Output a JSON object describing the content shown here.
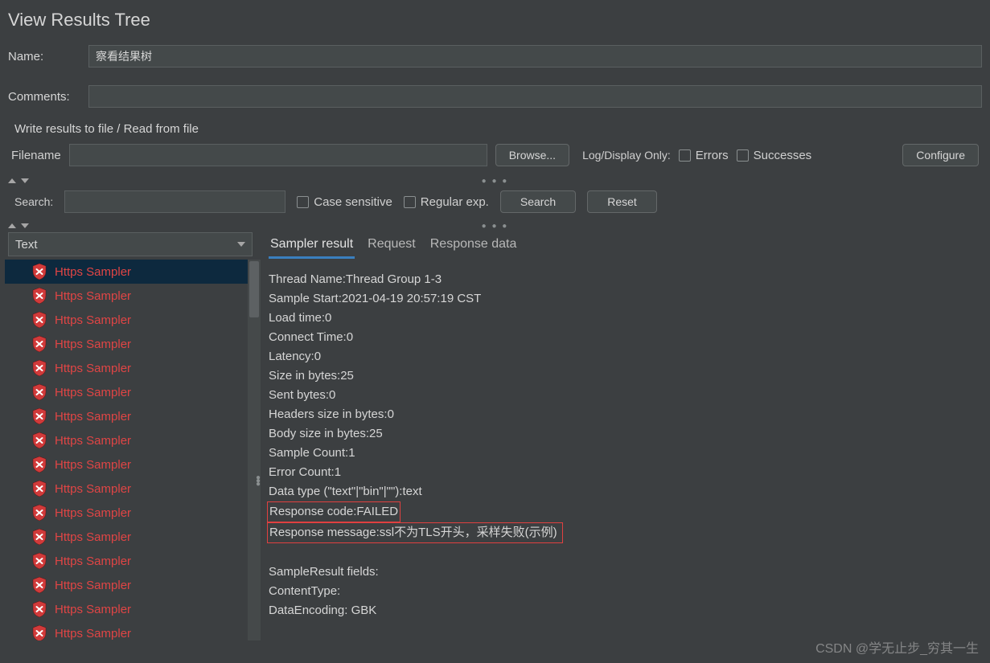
{
  "title": "View Results Tree",
  "form": {
    "name_label": "Name:",
    "name_value": "察看结果树",
    "comments_label": "Comments:",
    "comments_value": ""
  },
  "file_section": {
    "title": "Write results to file / Read from file",
    "filename_label": "Filename",
    "browse_label": "Browse...",
    "logdisplay_label": "Log/Display Only:",
    "errors_label": "Errors",
    "successes_label": "Successes",
    "configure_label": "Configure"
  },
  "search_bar": {
    "search_label": "Search:",
    "case_sensitive_label": "Case sensitive",
    "regex_label": "Regular exp.",
    "search_button": "Search",
    "reset_button": "Reset"
  },
  "left": {
    "selector": "Text",
    "items": [
      {
        "label": "Https Sampler",
        "selected": true
      },
      {
        "label": "Https Sampler"
      },
      {
        "label": "Https Sampler"
      },
      {
        "label": "Https Sampler"
      },
      {
        "label": "Https Sampler"
      },
      {
        "label": "Https Sampler"
      },
      {
        "label": "Https Sampler"
      },
      {
        "label": "Https Sampler"
      },
      {
        "label": "Https Sampler"
      },
      {
        "label": "Https Sampler"
      },
      {
        "label": "Https Sampler"
      },
      {
        "label": "Https Sampler"
      },
      {
        "label": "Https Sampler"
      },
      {
        "label": "Https Sampler"
      },
      {
        "label": "Https Sampler"
      },
      {
        "label": "Https Sampler"
      }
    ]
  },
  "tabs": {
    "items": [
      {
        "label": "Sampler result",
        "active": true
      },
      {
        "label": "Request"
      },
      {
        "label": "Response data"
      }
    ]
  },
  "result": {
    "lines": [
      "Thread Name:Thread Group 1-3",
      "Sample Start:2021-04-19 20:57:19 CST",
      "Load time:0",
      "Connect Time:0",
      "Latency:0",
      "Size in bytes:25",
      "Sent bytes:0",
      "Headers size in bytes:0",
      "Body size in bytes:25",
      "Sample Count:1",
      "Error Count:1",
      "Data type (\"text\"|\"bin\"|\"\"):text"
    ],
    "response_code": "Response code:FAILED",
    "response_message": "Response message:ssl不为TLS开头，采样失败(示例)",
    "footer": [
      "SampleResult fields:",
      "ContentType:",
      "DataEncoding: GBK"
    ]
  },
  "watermark": "CSDN @学无止步_穷其一生"
}
